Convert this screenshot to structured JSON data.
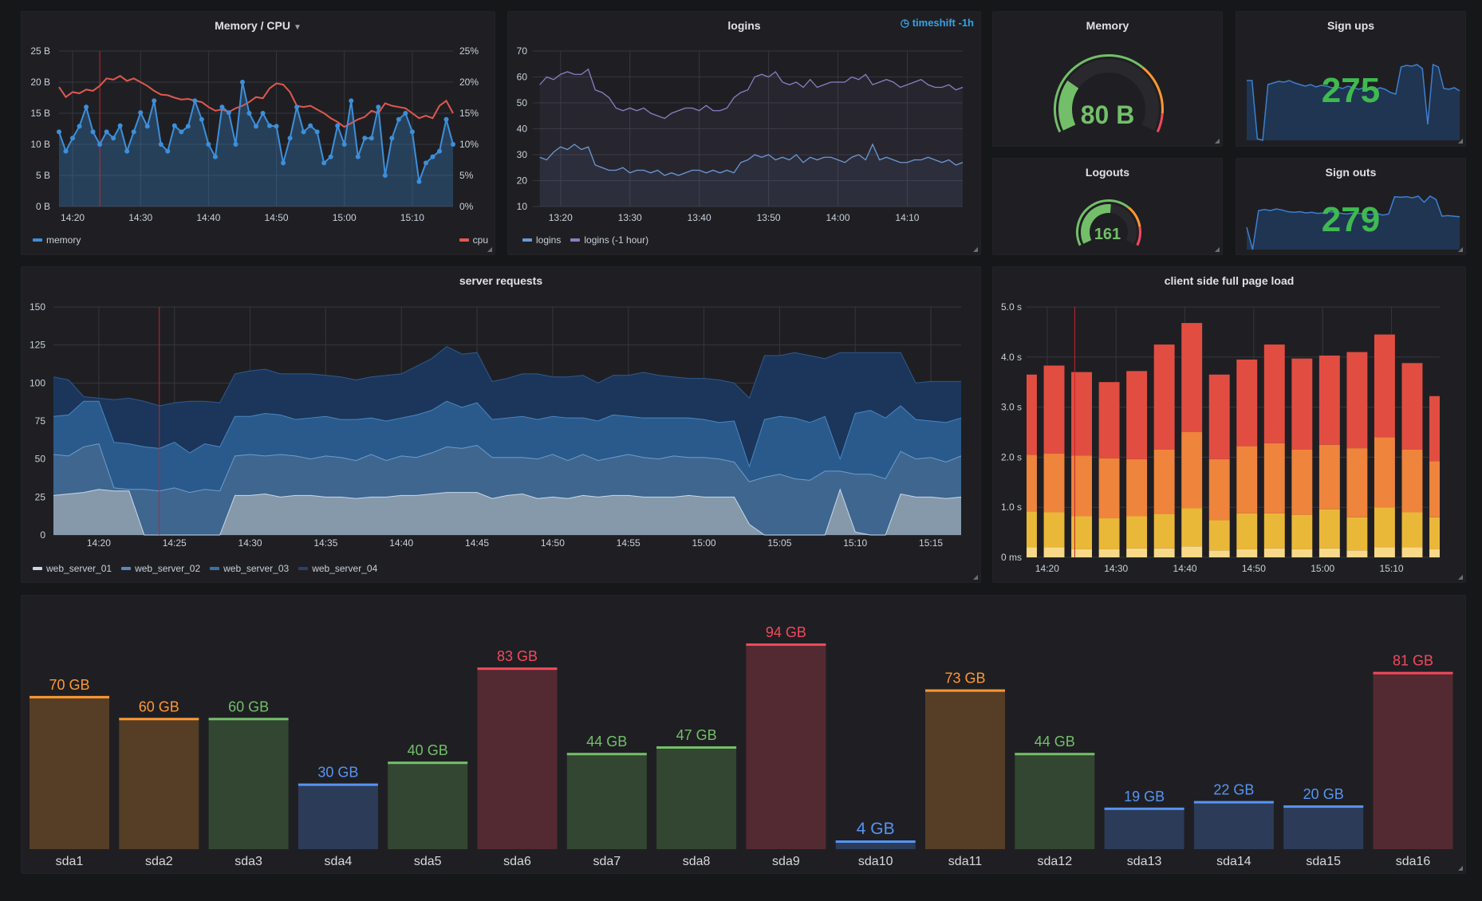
{
  "annotation_time": "14:24",
  "colors": {
    "panel_bg": "#1f1f23",
    "page_bg": "#161719",
    "grid": "#33363b",
    "annotation": "#c4262e"
  },
  "panels": {
    "memory_cpu": {
      "title": "Memory / CPU",
      "legend": [
        {
          "label": "memory",
          "color": "#3d8fd9"
        },
        {
          "label": "cpu",
          "color": "#e0584f"
        }
      ]
    },
    "logins": {
      "title": "logins",
      "timeshift": "timeshift -1h",
      "legend": [
        {
          "label": "logins",
          "color": "#6a9ad4"
        },
        {
          "label": "logins (-1 hour)",
          "color": "#8e7cc3"
        }
      ]
    },
    "memory_gauge": {
      "title": "Memory",
      "value": "80 B",
      "fill_fraction": 0.26,
      "color": "#73bf69",
      "thresholds": [
        {
          "color": "#73bf69",
          "to": 0.67
        },
        {
          "color": "#ff9830",
          "to": 0.91
        },
        {
          "color": "#f2495c",
          "to": 1
        }
      ]
    },
    "logouts_gauge": {
      "title": "Logouts",
      "value": "161",
      "fill_fraction": 0.52,
      "color": "#73bf69",
      "thresholds": [
        {
          "color": "#73bf69",
          "to": 0.67
        },
        {
          "color": "#ff9830",
          "to": 0.85
        },
        {
          "color": "#f2495c",
          "to": 1
        }
      ]
    },
    "sign_ups": {
      "title": "Sign ups",
      "value": "275",
      "color": "#3fb950",
      "sparkline": [
        75,
        75,
        2,
        0,
        70,
        72,
        74,
        73,
        75,
        72,
        70,
        68,
        70,
        67,
        69,
        68,
        66,
        67,
        65,
        68,
        66,
        64,
        66,
        65,
        62,
        66,
        64,
        60,
        58,
        92,
        94,
        93,
        95,
        90,
        20,
        95,
        92,
        65,
        64,
        66,
        62
      ]
    },
    "sign_outs": {
      "title": "Sign outs",
      "value": "279",
      "color": "#3fb950",
      "sparkline": [
        40,
        0,
        70,
        72,
        70,
        73,
        71,
        68,
        67,
        68,
        66,
        67,
        65,
        66,
        68,
        67,
        65,
        64,
        66,
        65,
        64,
        63,
        65,
        62,
        64,
        95,
        94,
        95,
        93,
        96,
        85,
        96,
        90,
        60,
        61,
        60,
        59
      ]
    },
    "server_requests": {
      "title": "server requests",
      "legend": [
        {
          "label": "web_server_01",
          "color": "#c8d8e8"
        },
        {
          "label": "web_server_02",
          "color": "#5a87b8"
        },
        {
          "label": "web_server_03",
          "color": "#3a70a8"
        },
        {
          "label": "web_server_04",
          "color": "#24436e"
        }
      ]
    },
    "client_load": {
      "title": "client side full page load"
    },
    "disk": {
      "title": ""
    }
  },
  "chart_data": [
    {
      "type": "line",
      "title": "Memory / CPU",
      "xlim": [
        "14:18",
        "15:16"
      ],
      "x_start": "14:18",
      "x_step_minutes": 1,
      "xticks": [
        "14:20",
        "14:30",
        "14:40",
        "14:50",
        "15:00",
        "15:10"
      ],
      "ylim": [
        0,
        25
      ],
      "yticks": [
        0,
        5,
        10,
        15,
        20,
        25
      ],
      "ytick_labels": [
        "0 B",
        "5 B",
        "10 B",
        "15 B",
        "20 B",
        "25 B"
      ],
      "y2lim": [
        0,
        25
      ],
      "y2tick_labels": [
        "0%",
        "5%",
        "10%",
        "15%",
        "20%",
        "25%"
      ],
      "grid": true,
      "legend_placement": "bottom",
      "series": [
        {
          "name": "memory",
          "axis": "left",
          "color": "#3d8fd9",
          "values": [
            12,
            8.9,
            11,
            12.9,
            16,
            12,
            10,
            12,
            11,
            13,
            8.9,
            12,
            15.1,
            12.9,
            17,
            10,
            8.9,
            13,
            12,
            12.9,
            17,
            14,
            10,
            8,
            16,
            15.1,
            10,
            20,
            15,
            12.9,
            15,
            13,
            12.9,
            7,
            11,
            16,
            12,
            13,
            12,
            7,
            8,
            13,
            10,
            17,
            8,
            11,
            11,
            16,
            5,
            11,
            14,
            15,
            12,
            4,
            7,
            8,
            8.9,
            14,
            10
          ]
        },
        {
          "name": "cpu",
          "axis": "right",
          "color": "#e0584f",
          "values": [
            19.2,
            17.6,
            18.4,
            18.2,
            18.8,
            18.6,
            19.4,
            20.6,
            20.4,
            21.0,
            20.2,
            20.6,
            20.0,
            19.4,
            18.6,
            18.0,
            17.9,
            17.5,
            17.2,
            17.3,
            17.0,
            16.8,
            16.0,
            15.4,
            15.6,
            15.2,
            15.8,
            16.2,
            16.8,
            17.6,
            17.4,
            19.0,
            19.8,
            19.6,
            18.4,
            16.2,
            16.0,
            16.2,
            15.6,
            15.0,
            14.2,
            13.6,
            12.8,
            13.4,
            14.0,
            14.4,
            15.4,
            15.0,
            16.6,
            16.2,
            16.0,
            15.8,
            15.0,
            14.2,
            14.6,
            14.2,
            16.2,
            17.0,
            15.0
          ]
        }
      ]
    },
    {
      "type": "line",
      "title": "logins",
      "xlim": [
        "13:16",
        "14:18"
      ],
      "x_start": "13:17",
      "x_step_minutes": 1,
      "xticks": [
        "13:20",
        "13:30",
        "13:40",
        "13:50",
        "14:00",
        "14:10"
      ],
      "ylim": [
        10,
        70
      ],
      "yticks": [
        10,
        20,
        30,
        40,
        50,
        60,
        70
      ],
      "ytick_labels": [
        "10",
        "20",
        "30",
        "40",
        "50",
        "60",
        "70"
      ],
      "grid": true,
      "legend_placement": "bottom",
      "series": [
        {
          "name": "logins",
          "color": "#6a9ad4",
          "values": [
            29,
            28,
            31,
            33,
            32,
            34,
            32,
            33,
            26,
            25,
            24,
            24,
            25,
            23,
            24,
            24,
            23,
            24,
            22,
            23,
            22,
            23,
            24,
            24,
            23,
            24,
            23,
            24,
            23,
            27,
            28,
            30,
            29,
            30,
            28,
            29,
            28,
            30,
            27,
            29,
            28,
            29,
            29,
            28,
            27,
            29,
            30,
            28,
            34,
            28,
            29,
            28,
            27,
            27,
            28,
            28,
            29,
            28,
            27,
            28,
            26,
            27
          ]
        },
        {
          "name": "logins (-1 hour)",
          "color": "#8e7cc3",
          "values": [
            57,
            60,
            59,
            61,
            62,
            61,
            61,
            63,
            55,
            54,
            52,
            48,
            47,
            48,
            47,
            48,
            46,
            45,
            44,
            46,
            47,
            48,
            48,
            47,
            49,
            47,
            47,
            48,
            52,
            54,
            55,
            60,
            61,
            60,
            62,
            58,
            57,
            58,
            56,
            59,
            56,
            57,
            58,
            58,
            58,
            60,
            59,
            61,
            57,
            58,
            59,
            58,
            56,
            57,
            58,
            59,
            57,
            56,
            56,
            57,
            55,
            56
          ]
        }
      ]
    },
    {
      "type": "area",
      "stacked": true,
      "title": "server requests",
      "xlim": [
        "14:17",
        "15:17"
      ],
      "x_start": "14:17",
      "x_step_minutes": 1,
      "xticks": [
        "14:20",
        "14:25",
        "14:30",
        "14:35",
        "14:40",
        "14:45",
        "14:50",
        "14:55",
        "15:00",
        "15:05",
        "15:10",
        "15:15"
      ],
      "ylim": [
        0,
        150
      ],
      "yticks": [
        0,
        25,
        50,
        75,
        100,
        125,
        150
      ],
      "ytick_labels": [
        "0",
        "25",
        "50",
        "75",
        "100",
        "125",
        "150"
      ],
      "grid": true,
      "legend_placement": "bottom",
      "series": [
        {
          "name": "web_server_01",
          "fill": "#8599ab",
          "line": "#c8d8e8",
          "values": [
            26,
            27,
            28,
            30,
            29,
            29,
            0,
            0,
            0,
            0,
            0,
            0,
            26,
            26,
            27,
            25,
            26,
            26,
            25,
            25,
            24,
            25,
            25,
            26,
            26,
            27,
            28,
            28,
            28,
            24,
            26,
            27,
            24,
            25,
            24,
            26,
            25,
            26,
            26,
            25,
            25,
            25,
            26,
            25,
            25,
            25,
            7,
            0,
            0,
            0,
            0,
            0,
            30,
            2,
            0,
            0,
            27,
            25,
            25,
            24,
            25
          ]
        },
        {
          "name": "web_server_02",
          "fill": "#3e668f",
          "line": "#6d9ccc",
          "values": [
            27,
            25,
            30,
            30,
            2,
            1,
            30,
            29,
            31,
            28,
            30,
            29,
            26,
            27,
            25,
            28,
            26,
            24,
            27,
            26,
            25,
            28,
            24,
            26,
            25,
            27,
            30,
            29,
            31,
            27,
            25,
            24,
            26,
            28,
            25,
            27,
            24,
            25,
            27,
            26,
            25,
            27,
            25,
            26,
            25,
            23,
            28,
            38,
            40,
            37,
            36,
            42,
            12,
            38,
            40,
            37,
            28,
            25,
            26,
            24,
            27
          ]
        },
        {
          "name": "web_server_03",
          "fill": "#2a5a8c",
          "line": "#4a85c0",
          "values": [
            25,
            27,
            30,
            28,
            30,
            30,
            28,
            28,
            30,
            26,
            30,
            29,
            26,
            25,
            28,
            26,
            24,
            27,
            26,
            25,
            27,
            24,
            26,
            25,
            28,
            28,
            30,
            27,
            28,
            25,
            26,
            27,
            26,
            25,
            28,
            24,
            26,
            28,
            25,
            26,
            27,
            25,
            26,
            25,
            24,
            27,
            10,
            38,
            38,
            40,
            38,
            36,
            8,
            40,
            42,
            40,
            30,
            26,
            24,
            26,
            25
          ]
        },
        {
          "name": "web_server_04",
          "fill": "#1b365a",
          "line": "#2e5a8e",
          "values": [
            26,
            23,
            3,
            2,
            28,
            30,
            30,
            28,
            26,
            34,
            28,
            29,
            28,
            30,
            29,
            27,
            30,
            29,
            27,
            28,
            26,
            27,
            30,
            29,
            32,
            34,
            36,
            35,
            33,
            25,
            26,
            28,
            30,
            26,
            27,
            28,
            25,
            26,
            27,
            30,
            28,
            27,
            26,
            27,
            28,
            25,
            45,
            42,
            40,
            43,
            44,
            38,
            70,
            40,
            38,
            43,
            35,
            24,
            26,
            27,
            24
          ]
        }
      ]
    },
    {
      "type": "bar",
      "stacked": true,
      "title": "client side full page load",
      "xlim": [
        "14:17",
        "15:17"
      ],
      "bar_start": "14:17",
      "bar_step_minutes": 4,
      "xticks": [
        "14:20",
        "14:30",
        "14:40",
        "14:50",
        "15:00",
        "15:10"
      ],
      "ylim": [
        0,
        5
      ],
      "yticks": [
        0,
        1,
        2,
        3,
        4,
        5
      ],
      "ytick_labels": [
        "0 ms",
        "1.0 s",
        "2.0 s",
        "3.0 s",
        "4.0 s",
        "5.0 s"
      ],
      "grid": true,
      "series": [
        {
          "color": "#f9d989",
          "values": [
            0.2,
            0.2,
            0.16,
            0.16,
            0.18,
            0.18,
            0.22,
            0.14,
            0.16,
            0.18,
            0.16,
            0.18,
            0.14,
            0.2,
            0.2,
            0.16
          ]
        },
        {
          "color": "#eab839",
          "values": [
            0.72,
            0.7,
            0.66,
            0.62,
            0.64,
            0.69,
            0.76,
            0.6,
            0.72,
            0.7,
            0.69,
            0.78,
            0.66,
            0.8,
            0.7,
            0.64
          ]
        },
        {
          "color": "#ef843c",
          "values": [
            1.13,
            1.17,
            1.21,
            1.2,
            1.14,
            1.28,
            1.52,
            1.22,
            1.34,
            1.4,
            1.3,
            1.29,
            1.38,
            1.4,
            1.25,
            1.12
          ]
        },
        {
          "color": "#e24d42",
          "values": [
            1.6,
            1.76,
            1.67,
            1.52,
            1.76,
            2.1,
            2.18,
            1.69,
            1.73,
            1.97,
            1.82,
            1.78,
            1.92,
            2.05,
            1.73,
            1.3
          ]
        }
      ]
    },
    {
      "type": "bar",
      "title": "",
      "unit": "GB",
      "ylim": [
        0,
        100
      ],
      "categories": [
        "sda1",
        "sda2",
        "sda3",
        "sda4",
        "sda5",
        "sda6",
        "sda7",
        "sda8",
        "sda9",
        "sda10",
        "sda11",
        "sda12",
        "sda13",
        "sda14",
        "sda15",
        "sda16"
      ],
      "values": [
        70,
        60,
        60,
        30,
        40,
        83,
        44,
        47,
        94,
        4,
        73,
        44,
        19,
        22,
        20,
        81
      ],
      "labels": [
        "70 GB",
        "60 GB",
        "60 GB",
        "30 GB",
        "40 GB",
        "83 GB",
        "44 GB",
        "47 GB",
        "94 GB",
        "4 GB",
        "73 GB",
        "44 GB",
        "19 GB",
        "22 GB",
        "20 GB",
        "81 GB"
      ],
      "colors": [
        "orange",
        "orange",
        "green",
        "blue",
        "green",
        "red",
        "green",
        "green",
        "red",
        "blue",
        "orange",
        "green",
        "blue",
        "blue",
        "blue",
        "red"
      ],
      "palette": {
        "blue": {
          "line": "#5794f2",
          "fill": "#2c3b58"
        },
        "green": {
          "line": "#73bf69",
          "fill": "#334631"
        },
        "orange": {
          "line": "#ff9830",
          "fill": "#553d26"
        },
        "red": {
          "line": "#f2495c",
          "fill": "#532a31"
        }
      }
    }
  ]
}
